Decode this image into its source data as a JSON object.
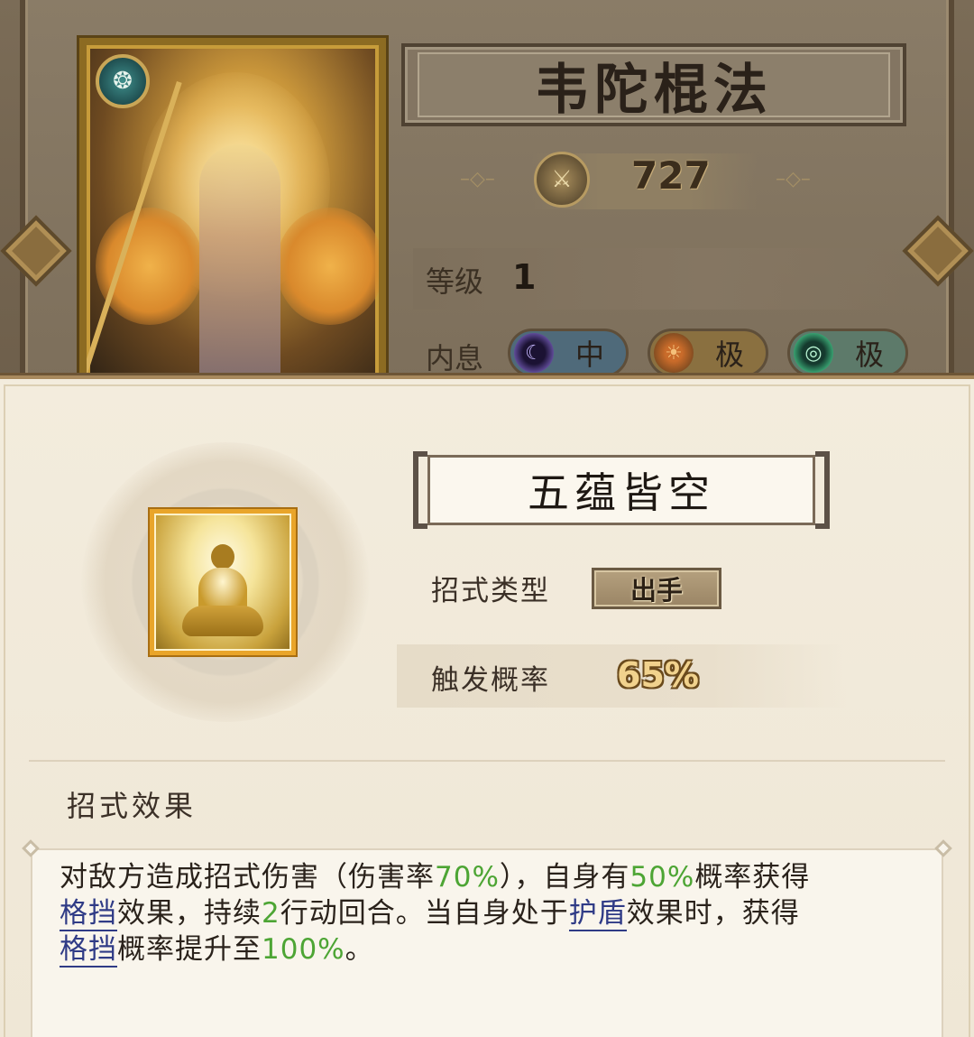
{
  "hero": {
    "skill_name": "韦陀棍法",
    "power": "727",
    "level_label": "等级",
    "level_value": "1",
    "neixi_label": "内息",
    "neixi": [
      {
        "icon": "purple-moon-icon",
        "grade": "中"
      },
      {
        "icon": "sun-gear-icon",
        "grade": "极"
      },
      {
        "icon": "green-ring-icon",
        "grade": "极"
      }
    ]
  },
  "move": {
    "name": "五蕴皆空",
    "type_label": "招式类型",
    "type_value": "出手",
    "rate_label": "触发概率",
    "rate_value": "65%",
    "effect_title": "招式效果",
    "effect_segments": [
      {
        "text": "对敌方造成招式伤害（伤害率",
        "kind": "plain"
      },
      {
        "text": "70%",
        "kind": "num"
      },
      {
        "text": "），自身有",
        "kind": "plain"
      },
      {
        "text": "50%",
        "kind": "num"
      },
      {
        "text": "概率获得",
        "kind": "plain"
      },
      {
        "text": "格挡",
        "kind": "keyword"
      },
      {
        "text": "效果，持续",
        "kind": "plain"
      },
      {
        "text": "2",
        "kind": "num"
      },
      {
        "text": "行动回合。当自身处于",
        "kind": "plain"
      },
      {
        "text": "护盾",
        "kind": "keyword"
      },
      {
        "text": "效果时，获得",
        "kind": "plain"
      },
      {
        "text": "格挡",
        "kind": "keyword"
      },
      {
        "text": "概率提升至",
        "kind": "plain"
      },
      {
        "text": "100%",
        "kind": "num"
      },
      {
        "text": "。",
        "kind": "plain"
      }
    ]
  },
  "colors": {
    "number_green": "#4da534",
    "keyword_blue": "#2f3b86",
    "icon_frame_gold": "#e9a52a"
  }
}
